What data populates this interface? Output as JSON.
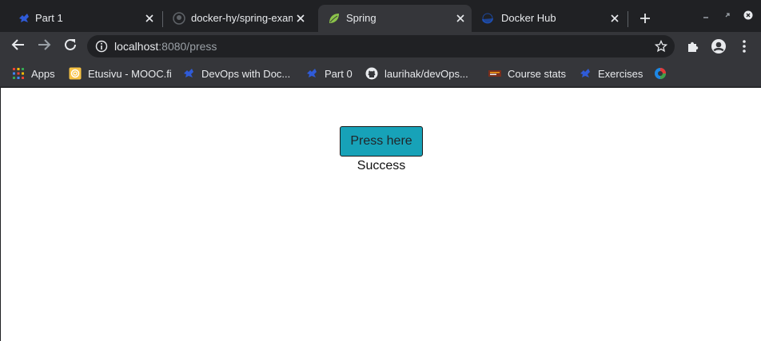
{
  "tabs": [
    {
      "title": "Part 1",
      "favicon": "devops-icon",
      "active": false
    },
    {
      "title": "docker-hy/spring-exam",
      "favicon": "github-icon",
      "active": false
    },
    {
      "title": "Spring",
      "favicon": "spring-leaf-icon",
      "active": true
    },
    {
      "title": "Docker Hub",
      "favicon": "docker-icon",
      "active": false
    }
  ],
  "toolbar": {
    "url_host": "localhost",
    "url_rest": ":8080/press"
  },
  "bookmarks": [
    {
      "label": "Apps",
      "icon": "apps-grid-icon"
    },
    {
      "label": "Etusivu - MOOC.fi",
      "icon": "mooc-icon"
    },
    {
      "label": "DevOps with Doc...",
      "icon": "devops-icon"
    },
    {
      "label": "Part 0",
      "icon": "devops-icon"
    },
    {
      "label": "laurihak/devOps...",
      "icon": "github-icon"
    },
    {
      "label": "Course stats",
      "icon": "course-stats-icon"
    },
    {
      "label": "Exercises",
      "icon": "devops-icon"
    },
    {
      "label": "",
      "icon": "extension-icon"
    }
  ],
  "page": {
    "button_label": "Press here",
    "status_text": "Success"
  },
  "colors": {
    "accent_button": "#17a2b8",
    "chrome_dark": "#202124",
    "chrome_toolbar": "#35363a"
  }
}
